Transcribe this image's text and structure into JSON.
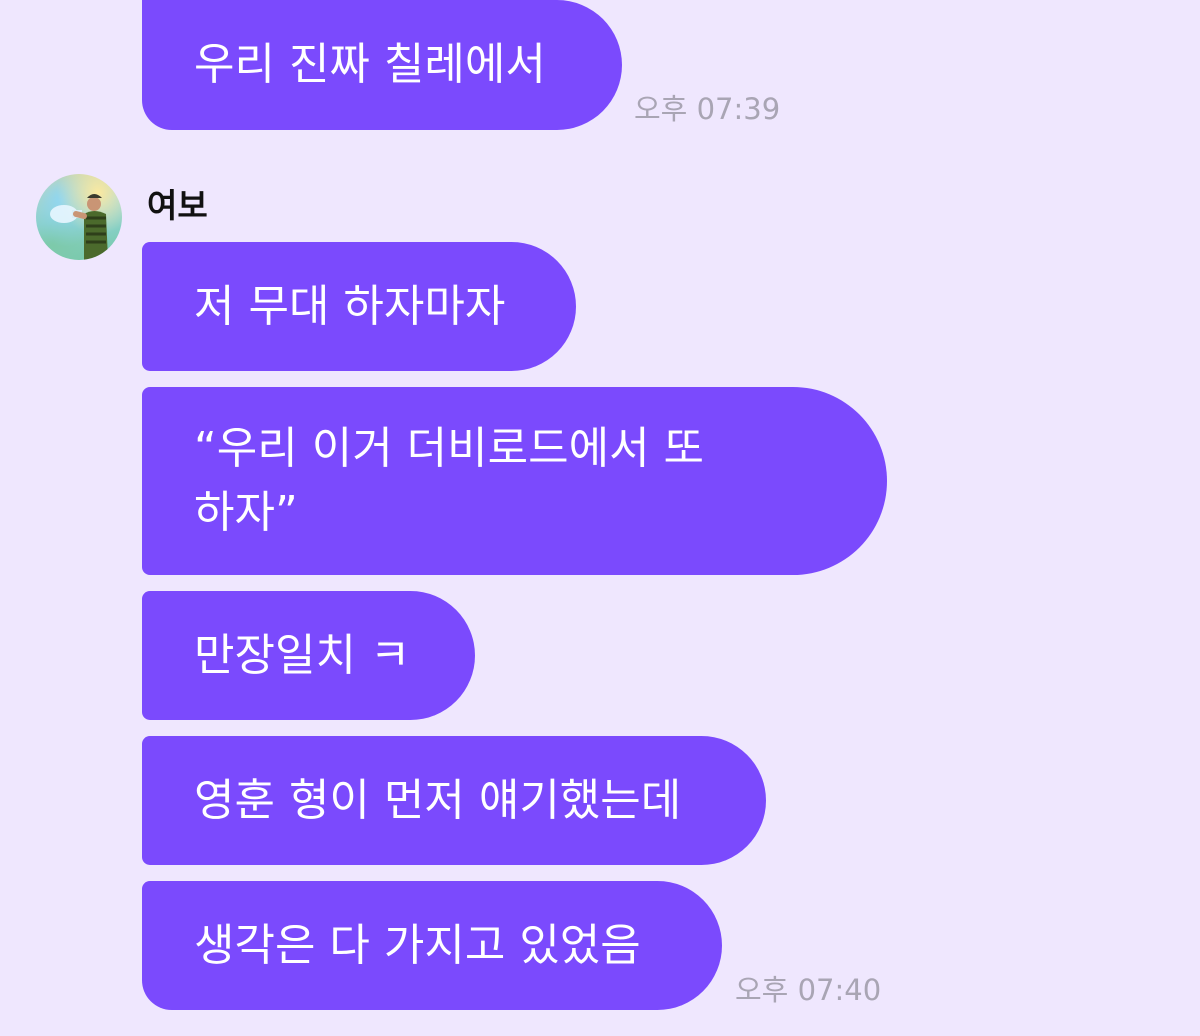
{
  "conversation": {
    "contact_name": "여보",
    "messages": [
      {
        "text": "우리 진짜 칠레에서"
      },
      {
        "text": "저 무대 하자마자"
      },
      {
        "text": "“우리 이거 더비로드에서 또 하자”"
      },
      {
        "text": "만장일치 ㅋ"
      },
      {
        "text": "영훈 형이 먼저 얘기했는데"
      },
      {
        "text": "생각은 다 가지고 있었음"
      }
    ],
    "times": [
      "오후 07:39",
      "오후 07:40"
    ]
  },
  "colors": {
    "background": "#EFE7FE",
    "bubble": "#7B4AFD",
    "bubble_text": "#FFFFFF",
    "timestamp": "#A9A5B4"
  },
  "icons": {
    "avatar": "profile-photo"
  }
}
